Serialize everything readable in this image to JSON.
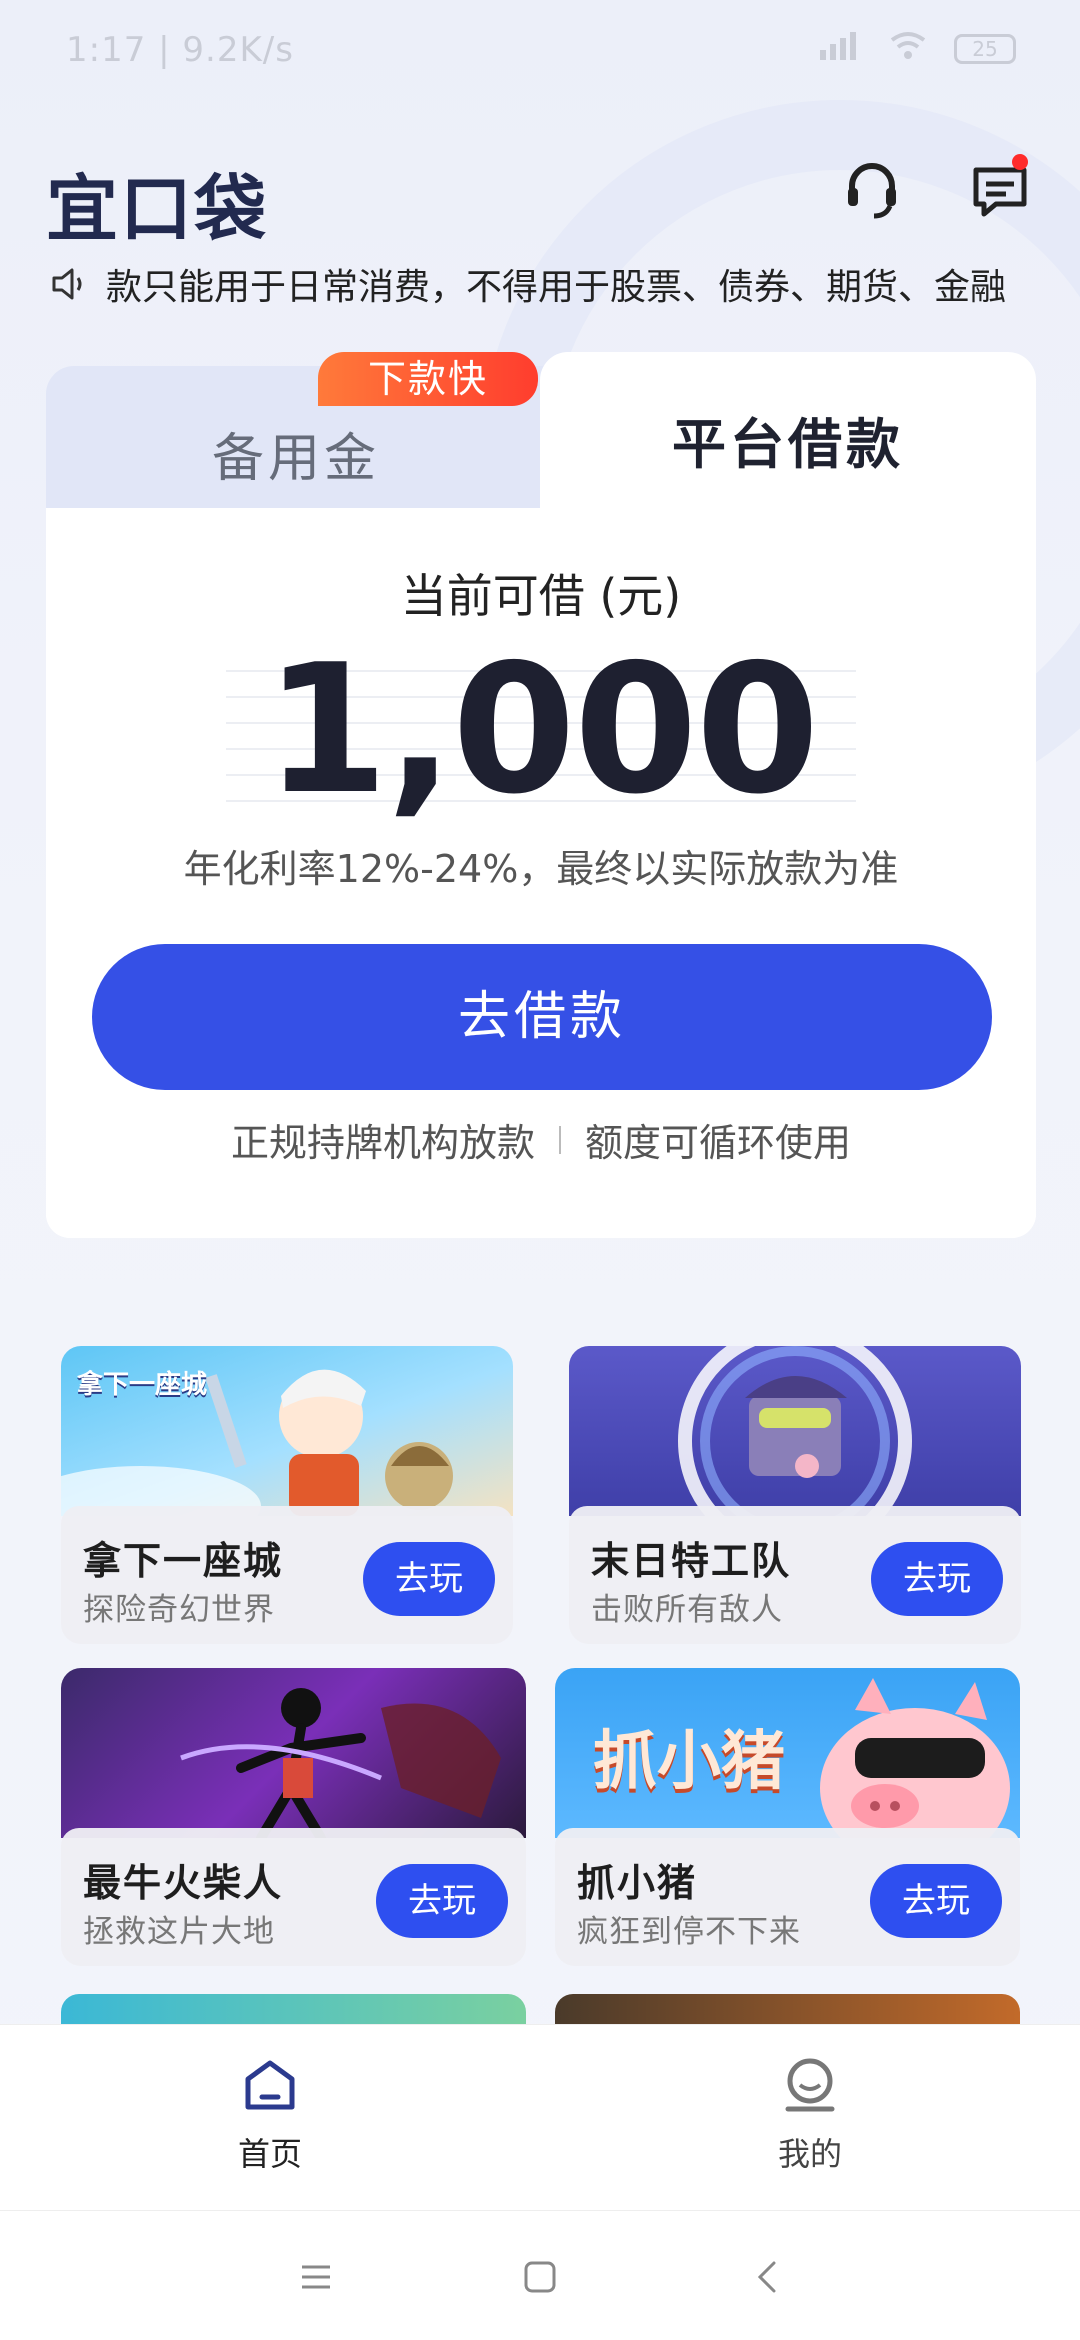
{
  "status_bar": {
    "time": "1:17 | 9.2K/s",
    "battery": "25"
  },
  "header": {
    "logo": "宜口袋",
    "icons": [
      "headset-icon",
      "message-icon"
    ],
    "has_unread": true
  },
  "notice": {
    "text": "款只能用于日常消费，不得用于股票、债券、期货、金融"
  },
  "loan_card": {
    "tabs": [
      {
        "label": "备用金",
        "badge": "下款快"
      },
      {
        "label": "平台借款"
      }
    ],
    "amount_label": "当前可借 (元)",
    "amount": "1,000",
    "rate_text": "年化利率12%-24%，最终以实际放款为准",
    "cta_label": "去借款",
    "features": [
      "正规持牌机构放款",
      "额度可循环使用"
    ]
  },
  "games": [
    {
      "name": "拿下一座城",
      "desc": "探险奇幻世界",
      "cta": "去玩",
      "art_text": "拿下一座城"
    },
    {
      "name": "末日特工队",
      "desc": "击败所有敌人",
      "cta": "去玩"
    },
    {
      "name": "最牛火柴人",
      "desc": "拯救这片大地",
      "cta": "去玩"
    },
    {
      "name": "抓小猪",
      "desc": "疯狂到停不下来",
      "cta": "去玩",
      "art_text": "抓小猪"
    }
  ],
  "bottom_nav": [
    {
      "label": "首页",
      "icon": "home-icon",
      "active": true
    },
    {
      "label": "我的",
      "icon": "profile-icon",
      "active": false
    }
  ],
  "colors": {
    "primary": "#3550e6",
    "badge": "#ff4a2e",
    "text_dark": "#1e2030"
  }
}
